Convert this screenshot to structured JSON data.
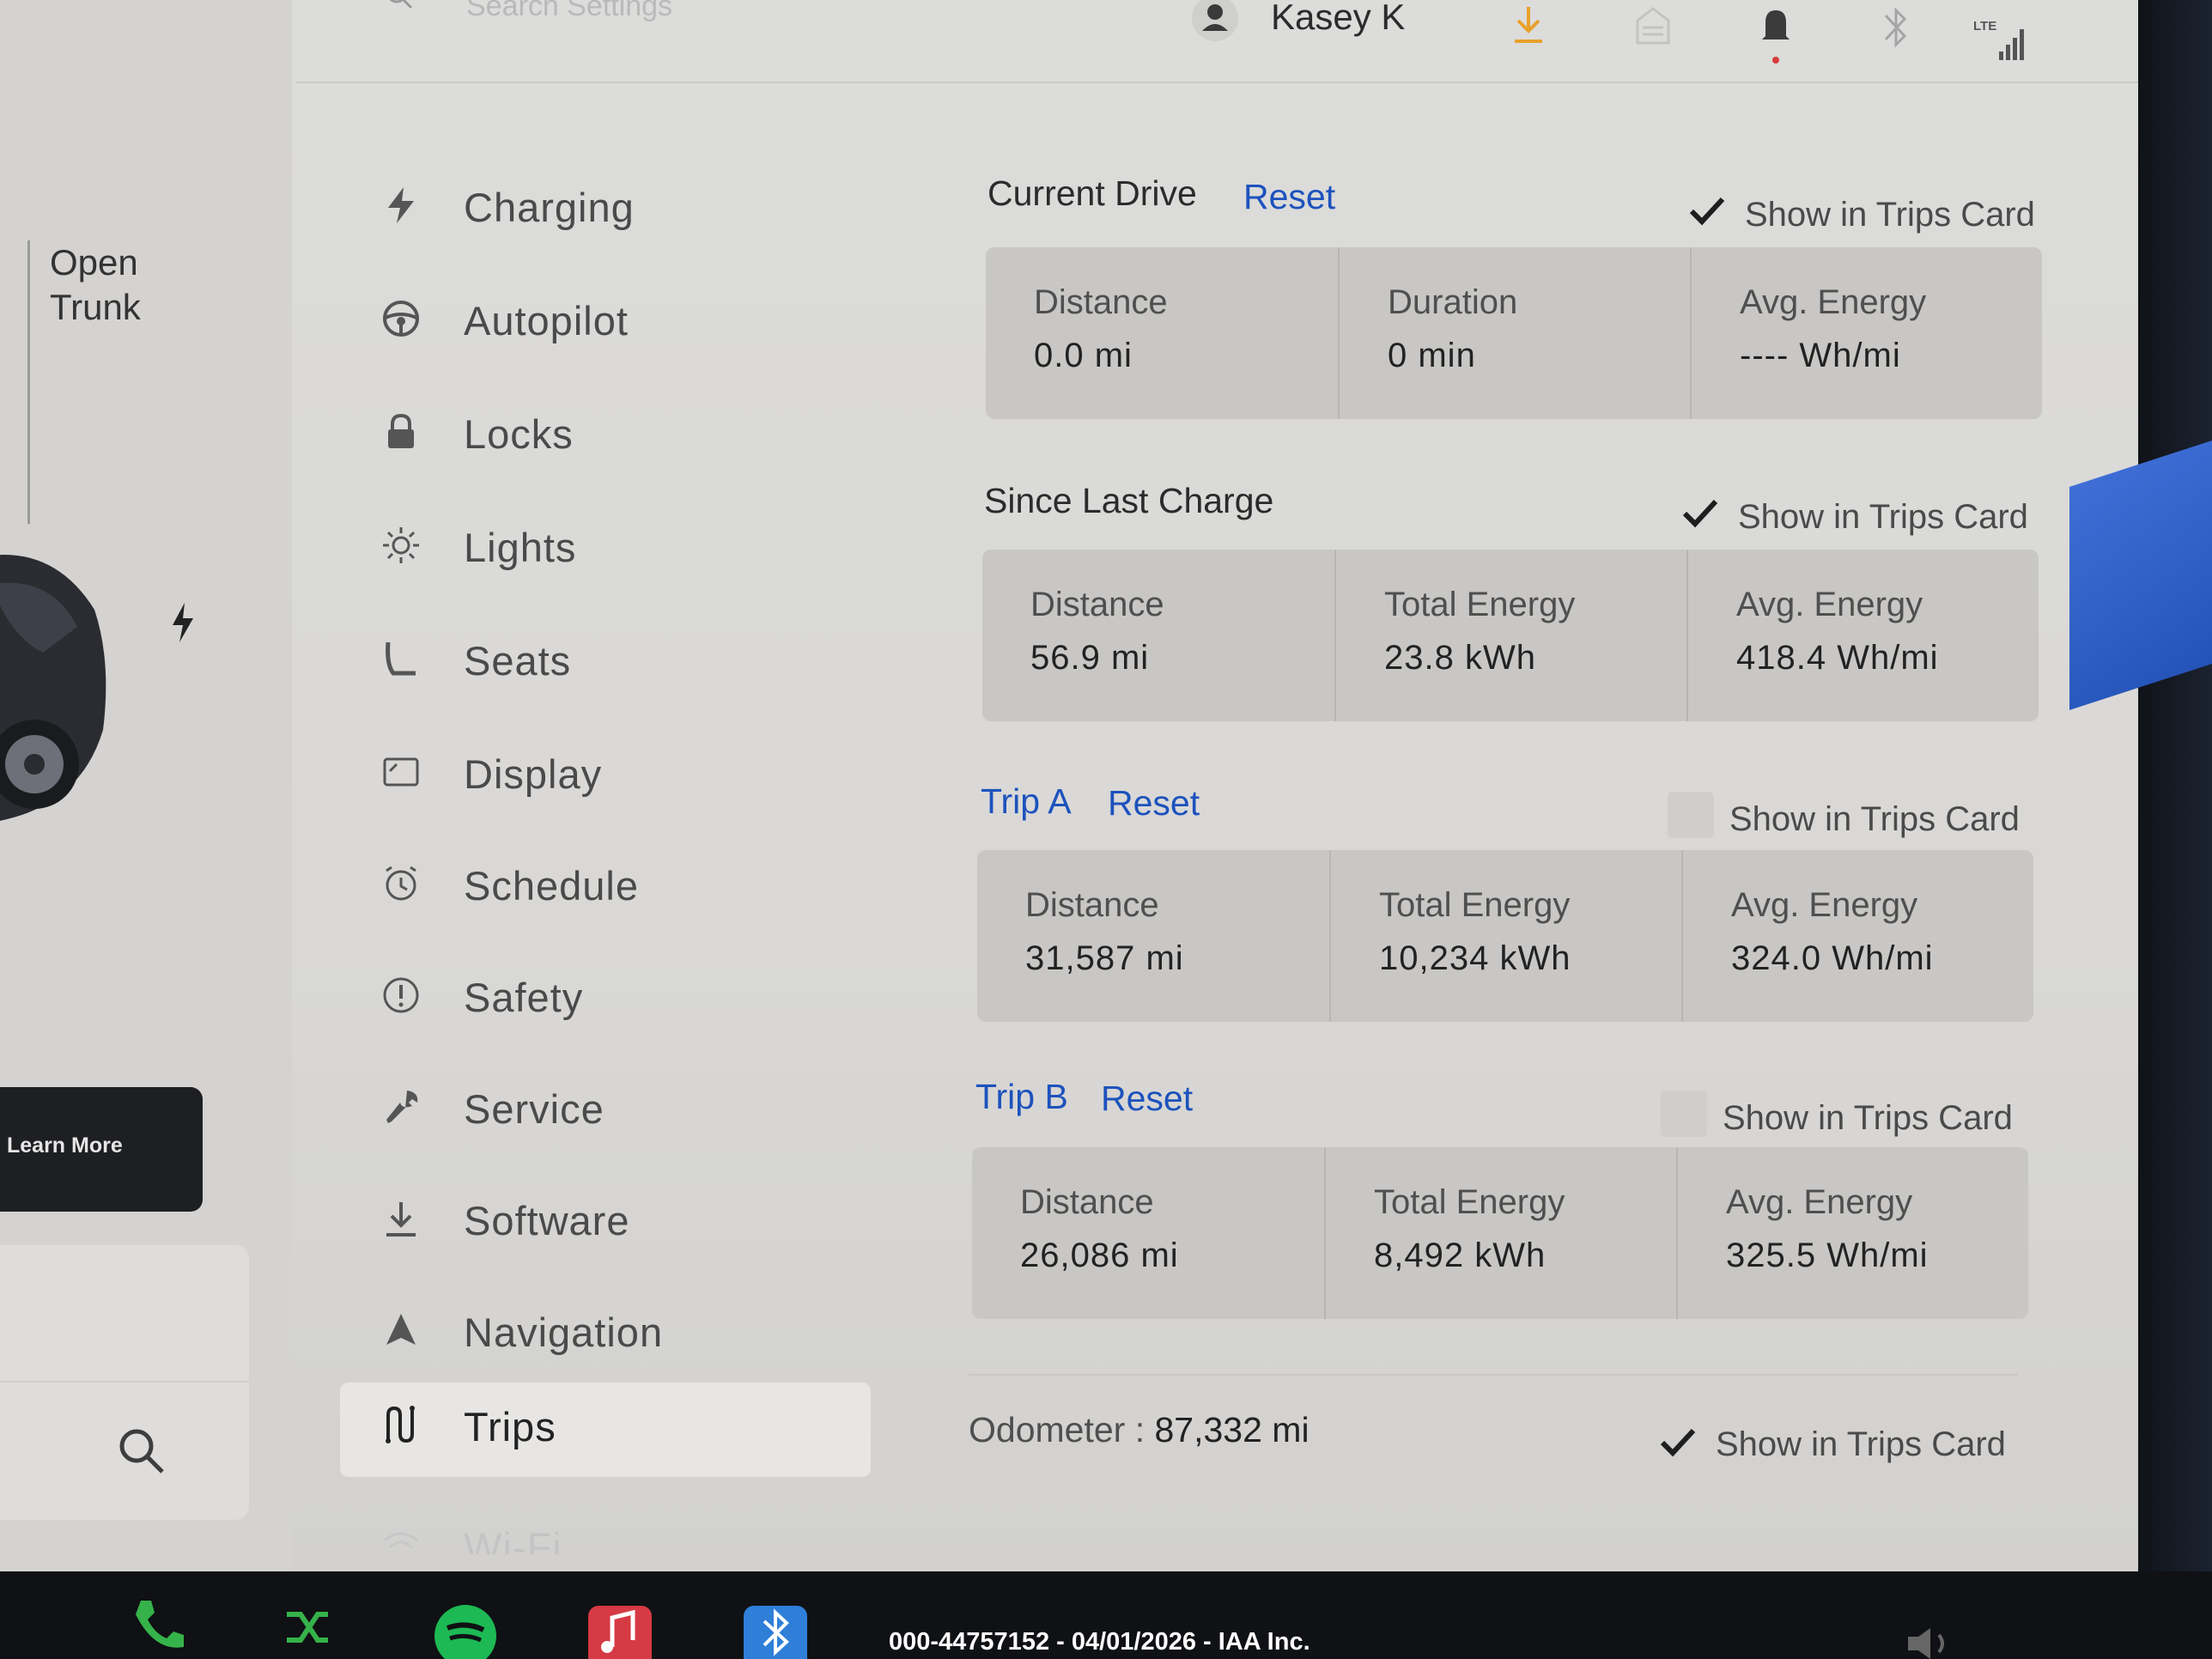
{
  "status_bar": {
    "search_placeholder": "Search Settings",
    "user_name": "Kasey K",
    "network_label": "LTE"
  },
  "left_panel": {
    "trunk_line1": "Open",
    "trunk_line2": "Trunk",
    "learn_more": "Learn More"
  },
  "menu": [
    {
      "label": "Charging",
      "icon": "bolt-icon"
    },
    {
      "label": "Autopilot",
      "icon": "steering-wheel-icon"
    },
    {
      "label": "Locks",
      "icon": "lock-icon"
    },
    {
      "label": "Lights",
      "icon": "sun-icon"
    },
    {
      "label": "Seats",
      "icon": "seat-icon"
    },
    {
      "label": "Display",
      "icon": "display-icon"
    },
    {
      "label": "Schedule",
      "icon": "alarm-clock-icon"
    },
    {
      "label": "Safety",
      "icon": "alert-circle-icon"
    },
    {
      "label": "Service",
      "icon": "wrench-icon"
    },
    {
      "label": "Software",
      "icon": "download-icon"
    },
    {
      "label": "Navigation",
      "icon": "navigation-arrow-icon"
    },
    {
      "label": "Trips",
      "icon": "trips-icon",
      "active": true
    },
    {
      "label": "Wi-Fi",
      "icon": "wifi-icon"
    }
  ],
  "sections": {
    "current_drive": {
      "title": "Current Drive",
      "reset": "Reset",
      "show_in_card": "Show in Trips Card",
      "checked": true,
      "cells": [
        {
          "label": "Distance",
          "value": "0.0  mi"
        },
        {
          "label": "Duration",
          "value": "0  min"
        },
        {
          "label": "Avg. Energy",
          "value": "----  Wh/mi"
        }
      ]
    },
    "since_last_charge": {
      "title": "Since Last Charge",
      "show_in_card": "Show in Trips Card",
      "checked": true,
      "cells": [
        {
          "label": "Distance",
          "value": "56.9  mi"
        },
        {
          "label": "Total Energy",
          "value": "23.8  kWh"
        },
        {
          "label": "Avg. Energy",
          "value": "418.4  Wh/mi"
        }
      ]
    },
    "trip_a": {
      "title": "Trip A",
      "reset": "Reset",
      "show_in_card": "Show in Trips Card",
      "checked": false,
      "cells": [
        {
          "label": "Distance",
          "value": "31,587  mi"
        },
        {
          "label": "Total Energy",
          "value": "10,234  kWh"
        },
        {
          "label": "Avg. Energy",
          "value": "324.0  Wh/mi"
        }
      ]
    },
    "trip_b": {
      "title": "Trip B",
      "reset": "Reset",
      "show_in_card": "Show in Trips Card",
      "checked": false,
      "cells": [
        {
          "label": "Distance",
          "value": "26,086  mi"
        },
        {
          "label": "Total Energy",
          "value": "8,492  kWh"
        },
        {
          "label": "Avg. Energy",
          "value": "325.5  Wh/mi"
        }
      ]
    },
    "odometer": {
      "label": "Odometer  :",
      "value": "87,332  mi",
      "show_in_card": "Show in Trips Card",
      "checked": true
    }
  },
  "caption": "000-44757152 - 04/01/2026 - IAA Inc.",
  "colors": {
    "accent_blue": "#1d52bd",
    "download_orange": "#e8a12a",
    "bell_red": "#d93a3a"
  }
}
